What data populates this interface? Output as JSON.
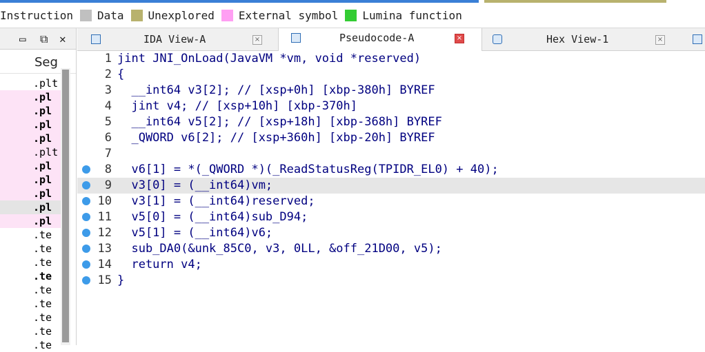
{
  "legend": {
    "items": [
      {
        "label": "Instruction",
        "color": null
      },
      {
        "label": "Data",
        "color": "#c0c0c0"
      },
      {
        "label": "Unexplored",
        "color": "#b8b26e"
      },
      {
        "label": "External symbol",
        "color": "#ff9ff3"
      },
      {
        "label": "Lumina function",
        "color": "#33cc33"
      }
    ]
  },
  "left_pane": {
    "controls": [
      "▭",
      "⧉",
      "✕"
    ],
    "header": "Seg",
    "rows": [
      {
        "text": ".plt",
        "style": "normal"
      },
      {
        "text": ".pl",
        "style": "pink-bold"
      },
      {
        "text": ".pl",
        "style": "pink-bold"
      },
      {
        "text": ".pl",
        "style": "pink-bold"
      },
      {
        "text": ".pl",
        "style": "pink-bold"
      },
      {
        "text": ".plt",
        "style": "pink"
      },
      {
        "text": ".pl",
        "style": "pink-bold"
      },
      {
        "text": ".pl",
        "style": "pink-bold"
      },
      {
        "text": ".pl",
        "style": "pink-bold"
      },
      {
        "text": ".pl",
        "style": "sel-bold"
      },
      {
        "text": ".pl",
        "style": "pink-bold"
      },
      {
        "text": ".te",
        "style": "normal"
      },
      {
        "text": ".te",
        "style": "normal"
      },
      {
        "text": ".te",
        "style": "normal"
      },
      {
        "text": ".te",
        "style": "bold"
      },
      {
        "text": ".te",
        "style": "normal"
      },
      {
        "text": ".te",
        "style": "normal"
      },
      {
        "text": ".te",
        "style": "normal"
      },
      {
        "text": ".te",
        "style": "normal"
      },
      {
        "text": ".te",
        "style": "normal"
      }
    ]
  },
  "tabs": [
    {
      "label": "IDA View-A",
      "active": false,
      "close_style": "gray"
    },
    {
      "label": "Pseudocode-A",
      "active": true,
      "close_style": "red"
    },
    {
      "label": "Hex View-1",
      "active": false,
      "close_style": "gray"
    }
  ],
  "code": {
    "lines": [
      {
        "n": "1",
        "dot": false,
        "text": "jint JNI_OnLoad(JavaVM *vm, void *reserved)"
      },
      {
        "n": "2",
        "dot": false,
        "text": "{"
      },
      {
        "n": "3",
        "dot": false,
        "text": "  __int64 v3[2]; // [xsp+0h] [xbp-380h] BYREF"
      },
      {
        "n": "4",
        "dot": false,
        "text": "  jint v4; // [xsp+10h] [xbp-370h]"
      },
      {
        "n": "5",
        "dot": false,
        "text": "  __int64 v5[2]; // [xsp+18h] [xbp-368h] BYREF"
      },
      {
        "n": "6",
        "dot": false,
        "text": "  _QWORD v6[2]; // [xsp+360h] [xbp-20h] BYREF"
      },
      {
        "n": "7",
        "dot": false,
        "text": ""
      },
      {
        "n": "8",
        "dot": true,
        "text": "  v6[1] = *(_QWORD *)(_ReadStatusReg(TPIDR_EL0) + 40);"
      },
      {
        "n": "9",
        "dot": true,
        "text": "  v3[0] = (__int64)vm;",
        "highlight": true
      },
      {
        "n": "10",
        "dot": true,
        "text": "  v3[1] = (__int64)reserved;"
      },
      {
        "n": "11",
        "dot": true,
        "text": "  v5[0] = (__int64)sub_D94;"
      },
      {
        "n": "12",
        "dot": true,
        "text": "  v5[1] = (__int64)v6;"
      },
      {
        "n": "13",
        "dot": true,
        "text": "  sub_DA0(&unk_85C0, v3, 0LL, &off_21D00, v5);"
      },
      {
        "n": "14",
        "dot": true,
        "text": "  return v4;"
      },
      {
        "n": "15",
        "dot": true,
        "text": "}"
      }
    ]
  }
}
